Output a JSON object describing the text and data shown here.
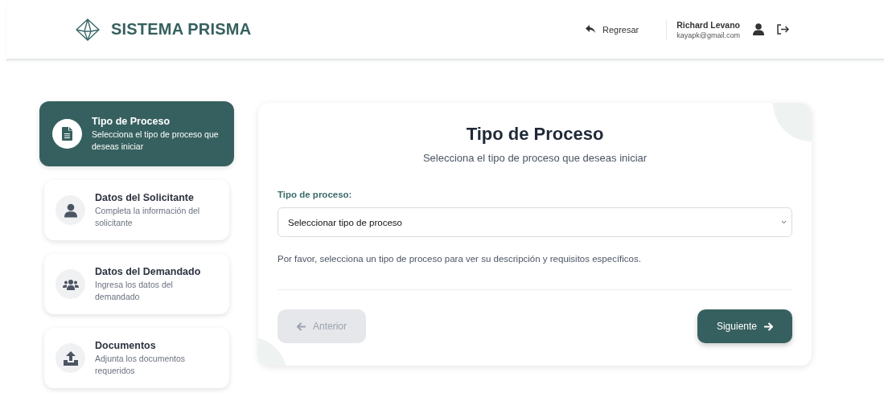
{
  "header": {
    "brand": "SISTEMA PRISMA",
    "back_link": "Regresar",
    "user": {
      "name": "Richard Levano",
      "email": "kayapk@gmail.com"
    }
  },
  "steps": [
    {
      "kind": "file",
      "title": "Tipo de Proceso",
      "description": "Selecciona el tipo de proceso que deseas iniciar",
      "selected": true
    },
    {
      "kind": "user",
      "title": "Datos del Solicitante",
      "description": "Completa la información del solicitante",
      "selected": false
    },
    {
      "kind": "users",
      "title": "Datos del Demandado",
      "description": "Ingresa los datos del demandado",
      "selected": false
    },
    {
      "kind": "upload",
      "title": "Documentos",
      "description": "Adjunta los documentos requeridos",
      "selected": false
    }
  ],
  "form": {
    "title": "Tipo de Proceso",
    "subtitle": "Selecciona el tipo de proceso que deseas iniciar",
    "field_label": "Tipo de proceso:",
    "select_value": "Seleccionar tipo de proceso",
    "hint": "Por favor, selecciona un tipo de proceso para ver su descripción y requisitos específicos.",
    "buttons": [
      {
        "kind": "back",
        "label": "Anterior",
        "disabled": true
      },
      {
        "kind": "next",
        "label": "Siguiente",
        "disabled": false
      }
    ]
  }
}
